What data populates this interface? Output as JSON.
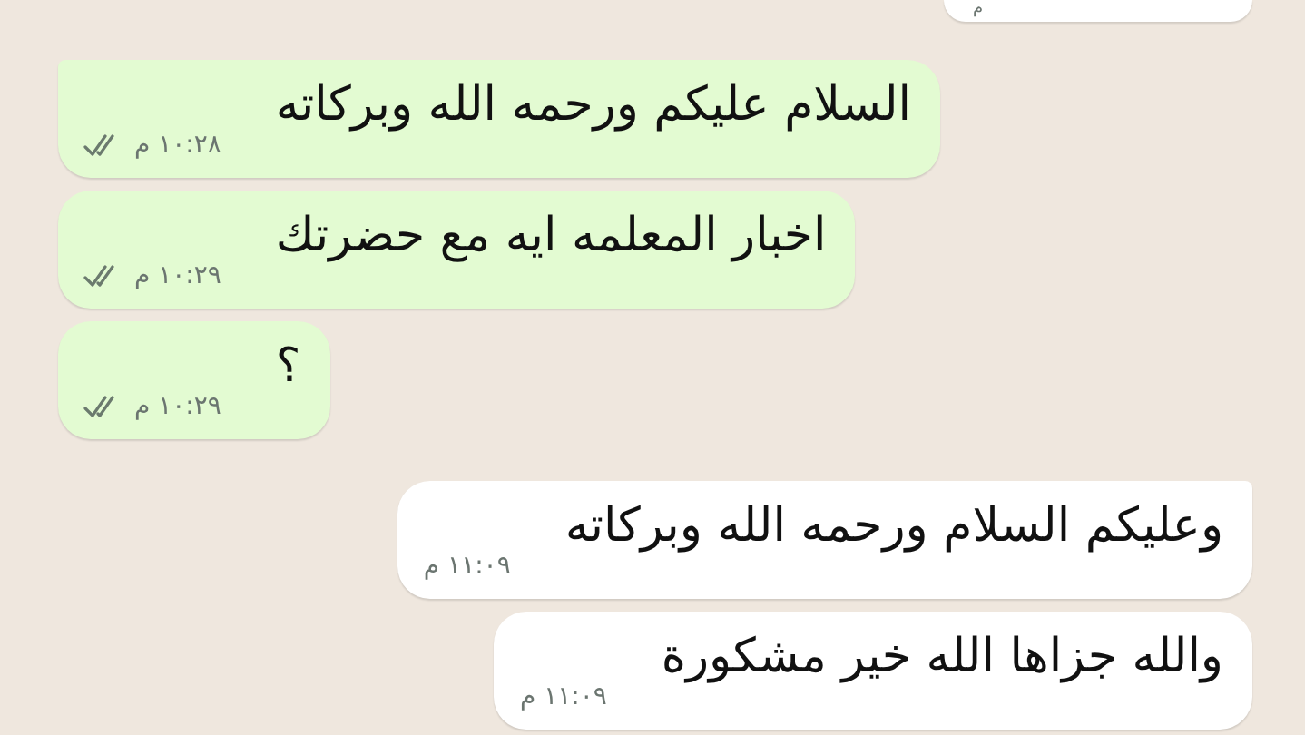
{
  "messages": [
    {
      "kind": "received",
      "time": "م",
      "cut": true
    },
    {
      "kind": "sent",
      "text": "السلام عليكم ورحمه الله وبركاته",
      "time": "١٠:٢٨ م",
      "first": true
    },
    {
      "kind": "sent",
      "text": "اخبار المعلمه ايه مع حضرتك",
      "time": "١٠:٢٩ م",
      "first": false
    },
    {
      "kind": "sent",
      "text": "؟",
      "time": "١٠:٢٩ م",
      "first": false
    },
    {
      "kind": "received",
      "text": "وعليكم السلام ورحمه الله وبركاته",
      "time": "١١:٠٩ م",
      "first": true
    },
    {
      "kind": "received",
      "text": "والله جزاها الله خير مشكورة",
      "time": "١١:٠٩ م",
      "first": false
    }
  ]
}
